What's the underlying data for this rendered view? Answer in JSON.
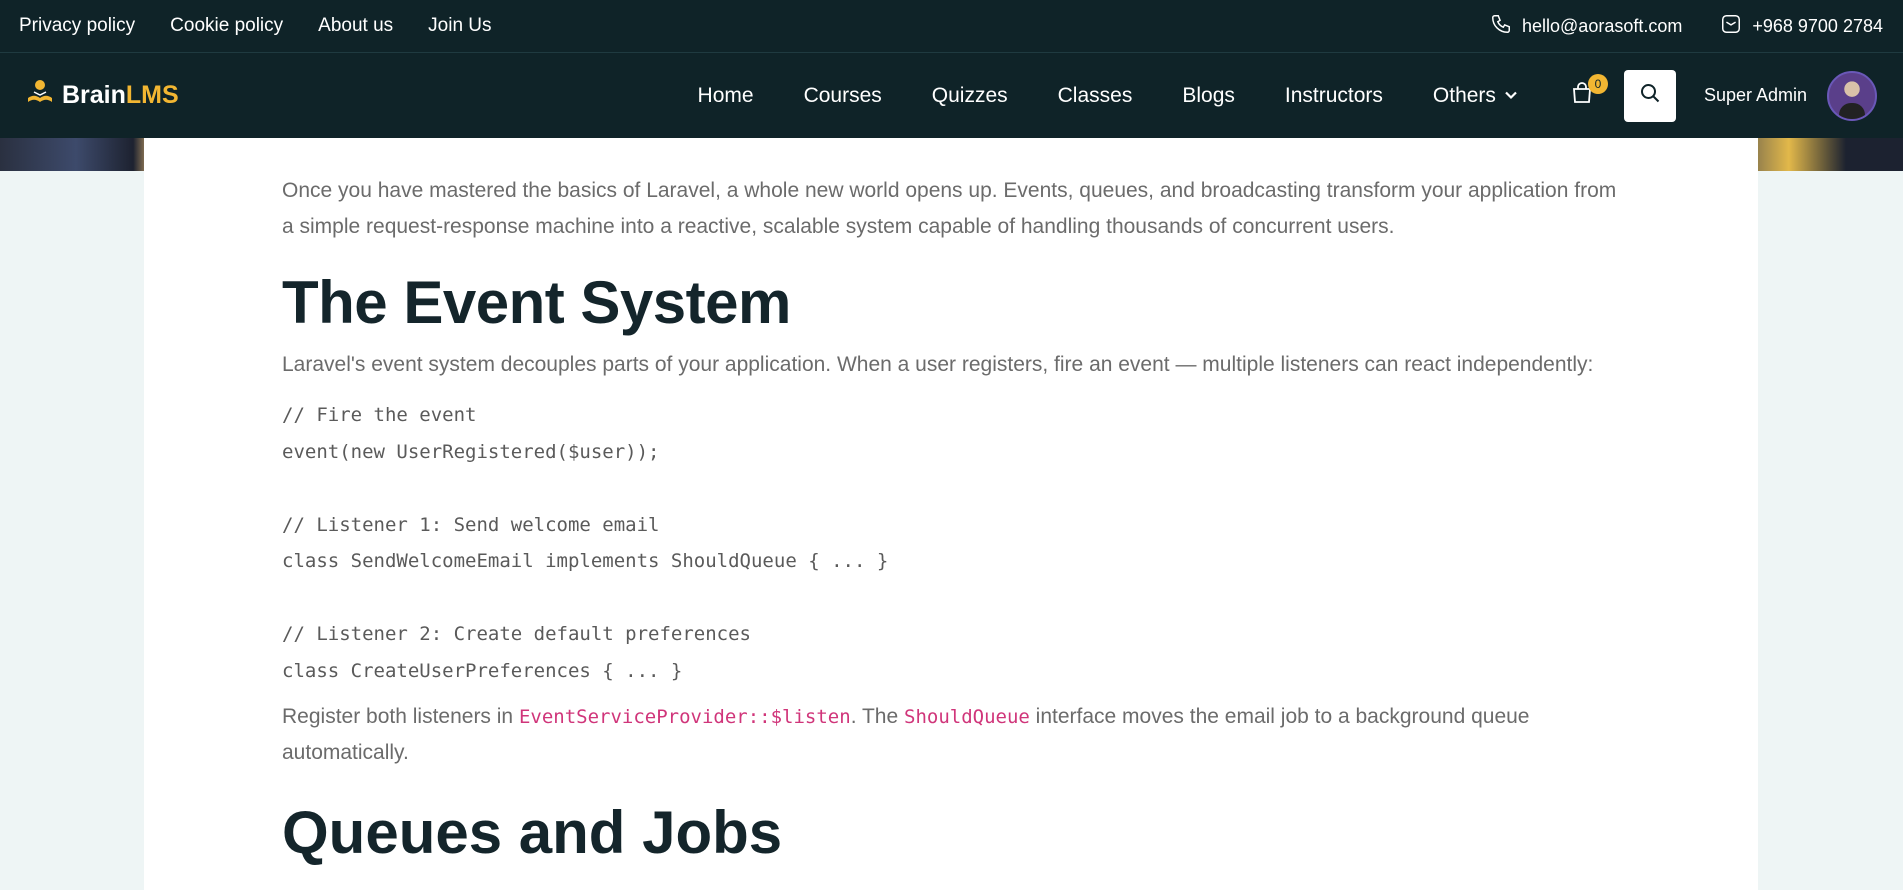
{
  "topbar": {
    "links": [
      "Privacy policy",
      "Cookie policy",
      "About us",
      "Join Us"
    ],
    "email": "hello@aorasoft.com",
    "phone": "+968 9700 2784"
  },
  "navbar": {
    "logo_brain": "Brain",
    "logo_lms": "LMS",
    "menu": [
      "Home",
      "Courses",
      "Quizzes",
      "Classes",
      "Blogs",
      "Instructors",
      "Others"
    ],
    "cart_count": "0",
    "user_name": "Super Admin"
  },
  "article": {
    "intro": "Once you have mastered the basics of Laravel, a whole new world opens up. Events, queues, and broadcasting transform your application from a simple request-response machine into a reactive, scalable system capable of handling thousands of concurrent users.",
    "heading": "The Event System",
    "para": "Laravel's event system decouples parts of your application. When a user registers, fire an event — multiple listeners can react independently:",
    "code": "// Fire the event\nevent(new UserRegistered($user));\n\n// Listener 1: Send welcome email\nclass SendWelcomeEmail implements ShouldQueue { ... }\n\n// Listener 2: Create default preferences\nclass CreateUserPreferences { ... }",
    "register_pre": "Register both listeners in ",
    "register_code1": "EventServiceProvider::$listen",
    "register_mid": ". The ",
    "register_code2": "ShouldQueue",
    "register_post": " interface moves the email job to a background queue automatically.",
    "next_heading": "Queues and Jobs"
  },
  "colors": {
    "nav_bg": "#0f2328",
    "accent": "#f2b632",
    "inline_code": "#d0357a"
  }
}
